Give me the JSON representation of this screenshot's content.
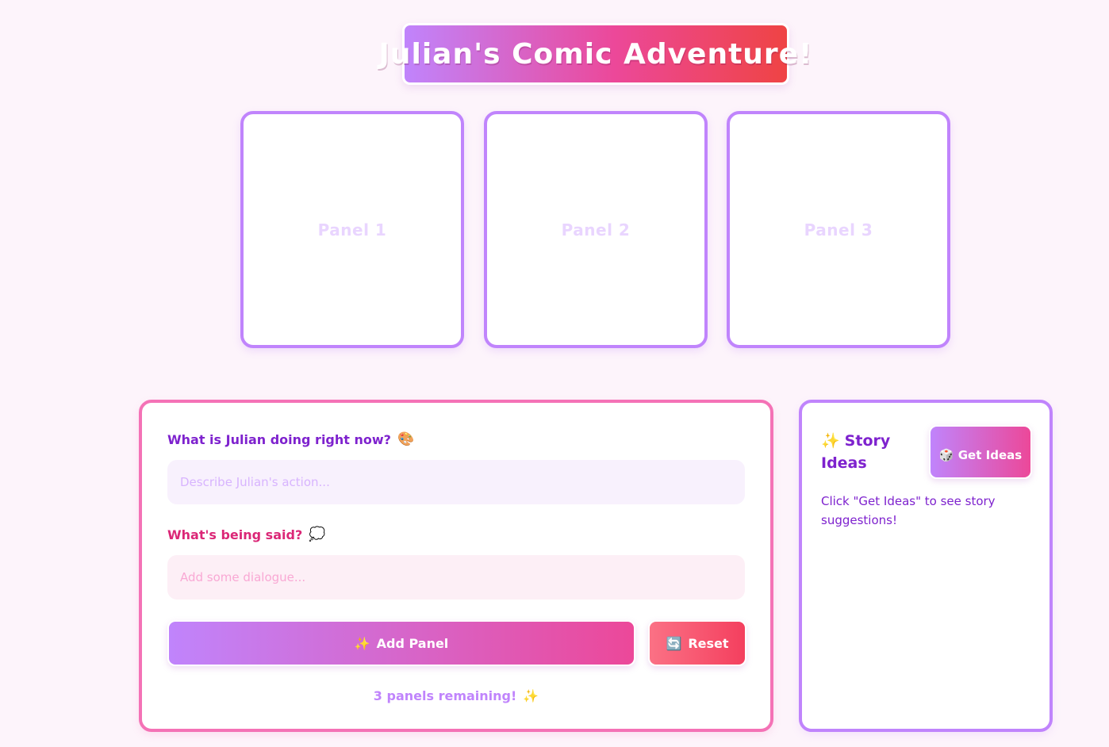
{
  "header": {
    "title": "Julian's Comic Adventure!"
  },
  "panels": [
    {
      "label": "Panel 1"
    },
    {
      "label": "Panel 2"
    },
    {
      "label": "Panel 3"
    }
  ],
  "editor": {
    "action_label": "What is Julian doing right now?",
    "action_emoji": "🎨",
    "action_placeholder": "Describe Julian's action...",
    "action_value": "",
    "dialogue_label": "What's being said?",
    "dialogue_emoji": "💭",
    "dialogue_placeholder": "Add some dialogue...",
    "dialogue_value": "",
    "add_button_icon": "✨",
    "add_button_label": "Add Panel",
    "reset_button_icon": "🔄",
    "reset_button_label": "Reset",
    "remaining_text": "3 panels remaining!",
    "remaining_emoji": "✨"
  },
  "ideas": {
    "title_icon": "✨",
    "title": "Story Ideas",
    "button_icon": "🎲",
    "button_label": "Get Ideas",
    "hint": "Click \"Get Ideas\" to see story suggestions!"
  },
  "colors": {
    "background": "#fdf4fb",
    "purple_accent": "#c084fc",
    "pink_accent": "#f472b6",
    "red_accent": "#ef4444",
    "label_purple": "#7e22ce",
    "label_pink": "#db2777"
  }
}
